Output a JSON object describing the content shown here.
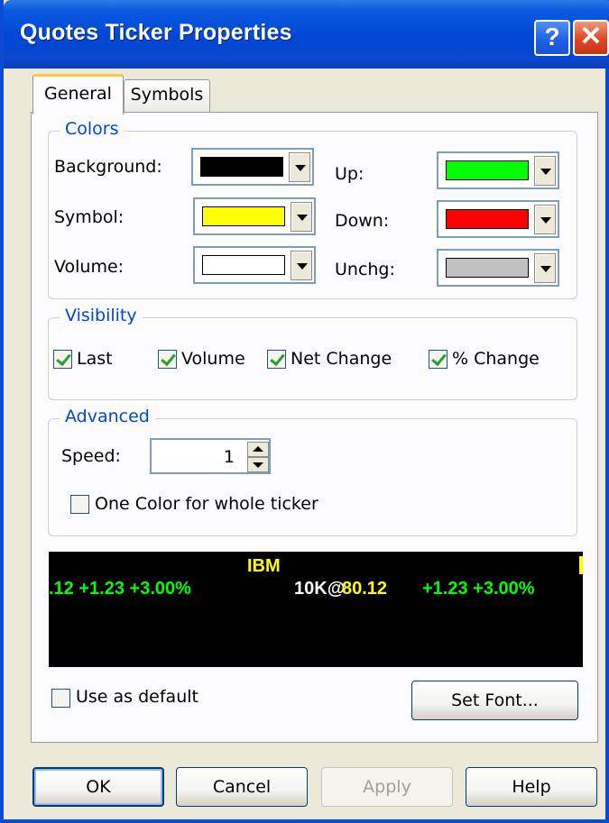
{
  "window": {
    "title": "Quotes Ticker Properties",
    "help_glyph": "?",
    "close_glyph": "✕"
  },
  "tabs": [
    {
      "label": "General",
      "selected": true
    },
    {
      "label": "Symbols",
      "selected": false
    }
  ],
  "colors_group": {
    "title": "Colors",
    "background_label": "Background:",
    "symbol_label": "Symbol:",
    "volume_label": "Volume:",
    "up_label": "Up:",
    "down_label": "Down:",
    "unchg_label": "Unchg:",
    "background_color": "#000000",
    "symbol_color": "#ffff00",
    "volume_color": "#ffffff",
    "up_color": "#00ff00",
    "down_color": "#ff0000",
    "unchg_color": "#c0c0c0"
  },
  "visibility_group": {
    "title": "Visibility",
    "last_label": "Last",
    "volume_label": "Volume",
    "net_change_label": "Net Change",
    "pct_change_label": "% Change",
    "last_checked": true,
    "volume_checked": true,
    "net_change_checked": true,
    "pct_change_checked": true
  },
  "advanced_group": {
    "title": "Advanced",
    "speed_label": "Speed:",
    "speed_value": "1",
    "one_color_label": "One Color for whole ticker",
    "one_color_checked": false
  },
  "ticker_preview": {
    "symbol": "IBM",
    "left_changes": ".12 +1.23 +3.00%",
    "volume": "10K@",
    "price": "80.12",
    "right_changes": "+1.23 +3.00%"
  },
  "use_default_label": "Use as default",
  "use_default_checked": false,
  "set_font_label": "Set Font...",
  "buttons": {
    "ok": "OK",
    "cancel": "Cancel",
    "apply": "Apply",
    "help": "Help"
  }
}
